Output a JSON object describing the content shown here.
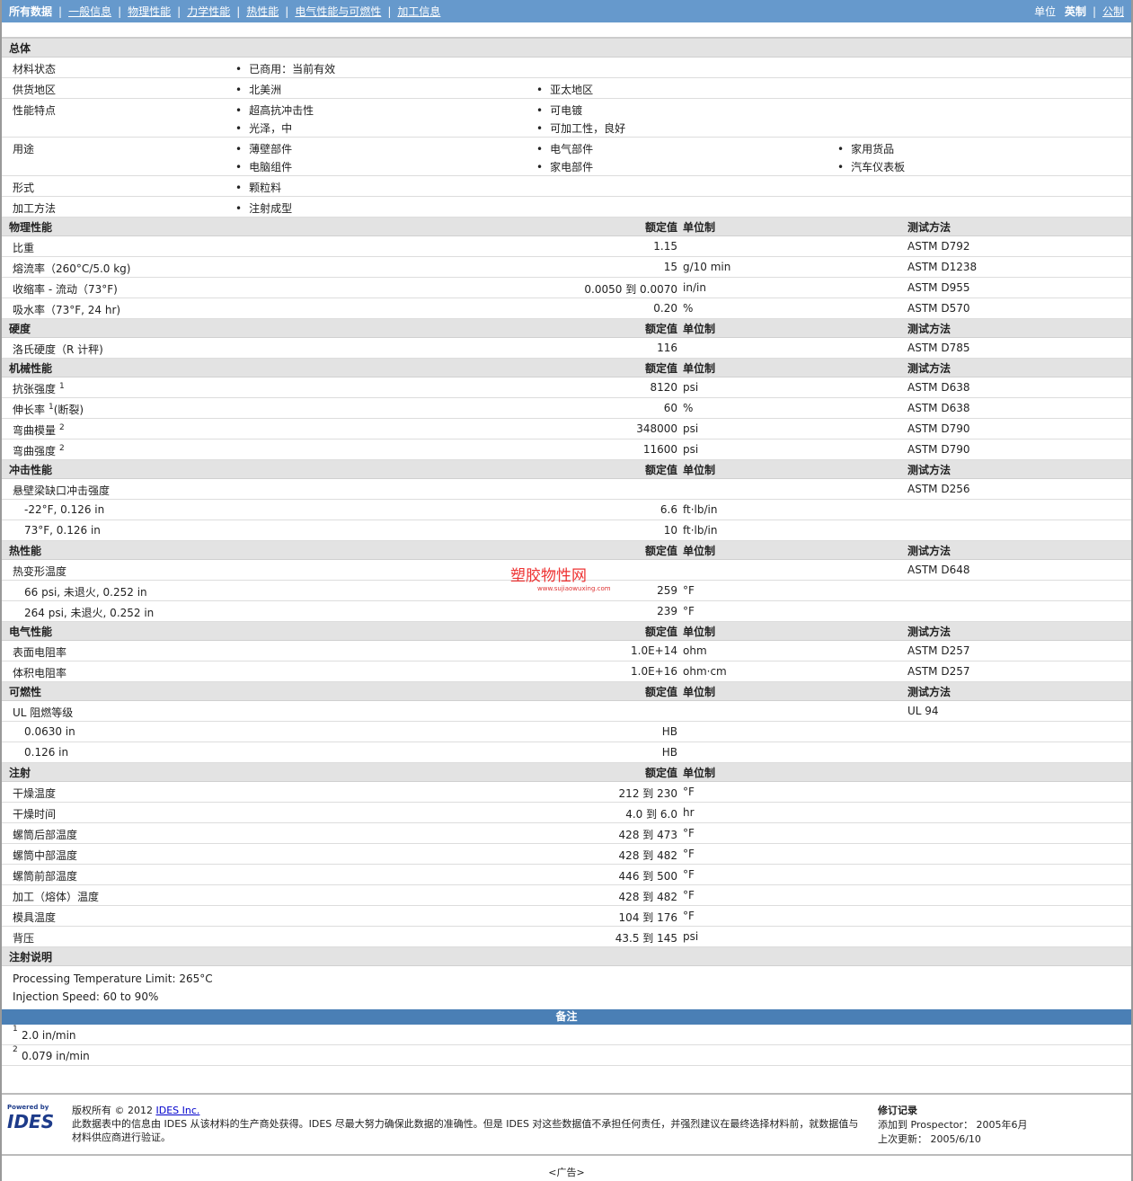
{
  "nav": {
    "items": [
      "所有数据",
      "一般信息",
      "物理性能",
      "力学性能",
      "热性能",
      "电气性能与可燃性",
      "加工信息"
    ],
    "units_label": "单位",
    "unit_english": "英制",
    "unit_metric": "公制"
  },
  "general": {
    "title": "总体",
    "rows": [
      {
        "label": "材料状态",
        "items": [
          "已商用：当前有效"
        ],
        "cols": 1
      },
      {
        "label": "供货地区",
        "items": [
          "北美洲",
          "亚太地区"
        ],
        "cols": 2
      },
      {
        "label": "性能特点",
        "items": [
          "超高抗冲击性",
          "可电镀",
          "光泽，中",
          "可加工性，良好"
        ],
        "cols": 2
      },
      {
        "label": "用途",
        "items": [
          "薄壁部件",
          "电气部件",
          "家用货品",
          "电脑组件",
          "家电部件",
          "汽车仪表板"
        ],
        "cols": 3
      },
      {
        "label": "形式",
        "items": [
          "颗粒料"
        ],
        "cols": 1
      },
      {
        "label": "加工方法",
        "items": [
          "注射成型"
        ],
        "cols": 1
      }
    ]
  },
  "col_headers": {
    "value": "额定值",
    "unit": "单位制",
    "method": "测试方法"
  },
  "sections": [
    {
      "title": "物理性能",
      "method": true,
      "rows": [
        {
          "label": "比重",
          "value": "1.15",
          "unit": "",
          "method": "ASTM D792"
        },
        {
          "label": "熔流率（260°C/5.0 kg)",
          "value": "15",
          "unit": "g/10 min",
          "method": "ASTM D1238"
        },
        {
          "label": "收缩率 - 流动（73°F)",
          "value": "0.0050 到  0.0070",
          "unit": "in/in",
          "method": "ASTM D955"
        },
        {
          "label": "吸水率（73°F, 24 hr)",
          "value": "0.20",
          "unit": "%",
          "method": "ASTM D570"
        }
      ]
    },
    {
      "title": "硬度",
      "method": true,
      "rows": [
        {
          "label": "洛氏硬度（R 计秤)",
          "value": "116",
          "unit": "",
          "method": "ASTM D785"
        }
      ]
    },
    {
      "title": "机械性能",
      "method": true,
      "rows": [
        {
          "label": "抗张强度",
          "sup": "1",
          "value": "8120",
          "unit": "psi",
          "method": "ASTM D638"
        },
        {
          "label": "伸长率",
          "sup": "1",
          "suffix": "(断裂)",
          "value": "60",
          "unit": "%",
          "method": "ASTM D638"
        },
        {
          "label": "弯曲模量",
          "sup": "2",
          "value": "348000",
          "unit": "psi",
          "method": "ASTM D790"
        },
        {
          "label": "弯曲强度",
          "sup": "2",
          "value": "11600",
          "unit": "psi",
          "method": "ASTM D790"
        }
      ]
    },
    {
      "title": "冲击性能",
      "method": true,
      "rows": [
        {
          "label": "悬壁梁缺口冲击强度",
          "value": "",
          "unit": "",
          "method": "ASTM D256"
        },
        {
          "label": "-22°F, 0.126 in",
          "indent": true,
          "value": "6.6",
          "unit": "ft·lb/in",
          "method": ""
        },
        {
          "label": "73°F, 0.126 in",
          "indent": true,
          "value": "10",
          "unit": "ft·lb/in",
          "method": ""
        }
      ]
    },
    {
      "title": "热性能",
      "method": true,
      "rows": [
        {
          "label": "热变形温度",
          "value": "",
          "unit": "",
          "method": "ASTM D648"
        },
        {
          "label": "66 psi, 未退火, 0.252 in",
          "indent": true,
          "value": "259",
          "unit": "°F",
          "method": ""
        },
        {
          "label": "264 psi, 未退火, 0.252 in",
          "indent": true,
          "value": "239",
          "unit": "°F",
          "method": ""
        }
      ]
    },
    {
      "title": "电气性能",
      "method": true,
      "rows": [
        {
          "label": "表面电阻率",
          "value": "1.0E+14",
          "unit": "ohm",
          "method": "ASTM D257"
        },
        {
          "label": "体积电阻率",
          "value": "1.0E+16",
          "unit": "ohm·cm",
          "method": "ASTM D257"
        }
      ]
    },
    {
      "title": "可燃性",
      "method": true,
      "rows": [
        {
          "label": "UL 阻燃等级",
          "value": "",
          "unit": "",
          "method": "UL 94"
        },
        {
          "label": "0.0630 in",
          "indent": true,
          "value": "HB",
          "unit": "",
          "method": ""
        },
        {
          "label": "0.126 in",
          "indent": true,
          "value": "HB",
          "unit": "",
          "method": ""
        }
      ]
    },
    {
      "title": "注射",
      "method": false,
      "rows": [
        {
          "label": "干燥温度",
          "value": "212 到  230",
          "unit": "°F",
          "method": ""
        },
        {
          "label": "干燥时间",
          "value": "4.0 到  6.0",
          "unit": "hr",
          "method": ""
        },
        {
          "label": "螺筒后部温度",
          "value": "428 到  473",
          "unit": "°F",
          "method": ""
        },
        {
          "label": "螺筒中部温度",
          "value": "428 到  482",
          "unit": "°F",
          "method": ""
        },
        {
          "label": "螺筒前部温度",
          "value": "446 到  500",
          "unit": "°F",
          "method": ""
        },
        {
          "label": "加工（熔体）温度",
          "value": "428 到  482",
          "unit": "°F",
          "method": ""
        },
        {
          "label": "模具温度",
          "value": "104 到  176",
          "unit": "°F",
          "method": ""
        },
        {
          "label": "背压",
          "value": "43.5 到  145",
          "unit": "psi",
          "method": ""
        }
      ]
    }
  ],
  "injection_notes": {
    "title": "注射说明",
    "lines": [
      "Processing Temperature Limit: 265°C",
      "Injection Speed: 60 to 90%"
    ]
  },
  "remarks": {
    "title": "备注",
    "footnotes": [
      {
        "num": "1",
        "text": "2.0 in/min"
      },
      {
        "num": "2",
        "text": "0.079 in/min"
      }
    ]
  },
  "watermark": {
    "text": "塑胶物性网",
    "url": "www.sujiaowuxing.com"
  },
  "footer": {
    "logo_powered": "Powered by",
    "logo": "IDES",
    "copyright": "版权所有  © 2012",
    "company_link": "IDES Inc.",
    "disclaimer": "此数据表中的信息由  IDES 从该材料的生产商处获得。IDES 尽最大努力确保此数据的准确性。但是  IDES 对这些数据值不承担任何责任，并强烈建议在最终选择材料前，就数据值与材料供应商进行验证。",
    "revision_title": "修订记录",
    "added_label": "添加到  Prospector：",
    "added_value": "2005年6月",
    "updated_label": "上次更新：",
    "updated_value": "2005/6/10"
  },
  "ad": "<广告>"
}
